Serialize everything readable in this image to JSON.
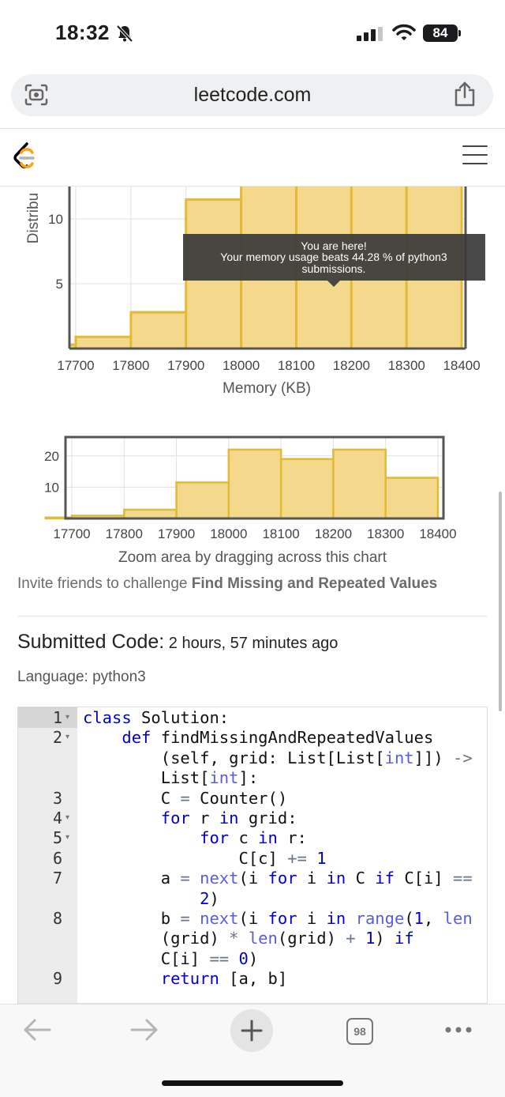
{
  "status_bar": {
    "time": "18:32",
    "battery": "84",
    "icons": [
      "bell-slash-icon",
      "signal-icon",
      "wifi-icon",
      "battery-icon"
    ]
  },
  "browser": {
    "url": "leetcode.com",
    "icons": [
      "camera-icon",
      "share-icon"
    ]
  },
  "header": {
    "icons": [
      "leetcode-logo",
      "hamburger-menu-icon"
    ]
  },
  "chart_data": [
    {
      "type": "bar",
      "ylabel": "Distribu",
      "xlabel": "Memory (KB)",
      "x_ticks": [
        "17700",
        "17800",
        "17900",
        "18000",
        "18100",
        "18200",
        "18300",
        "18400"
      ],
      "y_ticks": [
        "5",
        "10"
      ],
      "bins": [
        17650,
        17700,
        17800,
        17900,
        18000,
        18100,
        18200,
        18300,
        18400
      ],
      "values": [
        0.3,
        0.9,
        2.8,
        11.5,
        22,
        19,
        22,
        13
      ],
      "ylim": [
        0,
        12.5
      ],
      "color": "#f4d98d",
      "stroke": "#e2ba36",
      "tooltip": {
        "line1": "You are here!",
        "line2": "Your memory usage beats 44.28 % of python3",
        "line3": "submissions."
      }
    },
    {
      "type": "bar",
      "x_ticks": [
        "17700",
        "17800",
        "17900",
        "18000",
        "18100",
        "18200",
        "18300",
        "18400"
      ],
      "y_ticks": [
        "10",
        "20"
      ],
      "bins": [
        17650,
        17700,
        17800,
        17900,
        18000,
        18100,
        18200,
        18300,
        18400
      ],
      "values": [
        0.3,
        0.9,
        2.8,
        11.5,
        22,
        19,
        22,
        13
      ],
      "ylim": [
        0,
        26
      ]
    }
  ],
  "zoom_text": "Zoom area by dragging across this chart",
  "invite": {
    "prefix": "Invite friends to challenge ",
    "problem": "Find Missing and Repeated Values"
  },
  "submission": {
    "label": "Submitted Code:",
    "time": " 2 hours, 57 minutes ago",
    "language": "Language: python3"
  },
  "code": [
    {
      "num": "1",
      "fold": true,
      "html": "<span class=\"kw\">class</span> Solution:"
    },
    {
      "num": "2",
      "fold": true,
      "html": "    <span class=\"kw\">def</span> findMissingAndRepeatedValues"
    },
    {
      "num": "",
      "fold": false,
      "html": "        (self, grid: List[List[<span class=\"builtin\">int</span>]]) <span class=\"op\">-&gt;</span>"
    },
    {
      "num": "",
      "fold": false,
      "html": "        List[<span class=\"builtin\">int</span>]:"
    },
    {
      "num": "3",
      "fold": false,
      "html": "        C <span class=\"op\">=</span> Counter()"
    },
    {
      "num": "4",
      "fold": true,
      "html": "        <span class=\"kw\">for</span> r <span class=\"kw\">in</span> grid:"
    },
    {
      "num": "5",
      "fold": true,
      "html": "            <span class=\"kw\">for</span> c <span class=\"kw\">in</span> r:"
    },
    {
      "num": "6",
      "fold": false,
      "html": "                C[c] <span class=\"op\">+=</span> <span class=\"num\">1</span>"
    },
    {
      "num": "7",
      "fold": false,
      "html": "        a <span class=\"op\">=</span> <span class=\"builtin\">next</span>(i <span class=\"kw\">for</span> i <span class=\"kw\">in</span> C <span class=\"kw\">if</span> C[i] <span class=\"op\">==</span>"
    },
    {
      "num": "",
      "fold": false,
      "html": "            <span class=\"num\">2</span>)"
    },
    {
      "num": "8",
      "fold": false,
      "html": "        b <span class=\"op\">=</span> <span class=\"builtin\">next</span>(i <span class=\"kw\">for</span> i <span class=\"kw\">in</span> <span class=\"builtin\">range</span>(<span class=\"num\">1</span>, <span class=\"builtin\">len</span>"
    },
    {
      "num": "",
      "fold": false,
      "html": "        (grid) <span class=\"op\">*</span> <span class=\"builtin\">len</span>(grid) <span class=\"op\">+</span> <span class=\"num\">1</span>) <span class=\"kw\">if</span>"
    },
    {
      "num": "",
      "fold": false,
      "html": "        C[i] <span class=\"op\">==</span> <span class=\"num\">0</span>)"
    },
    {
      "num": "9",
      "fold": false,
      "html": "        <span class=\"kw\">return</span> [a, b]"
    }
  ],
  "bottom_bar": {
    "tab_count": "98",
    "icons": [
      "back-arrow-icon",
      "forward-arrow-icon",
      "plus-icon",
      "tabs-icon",
      "more-icon"
    ]
  }
}
